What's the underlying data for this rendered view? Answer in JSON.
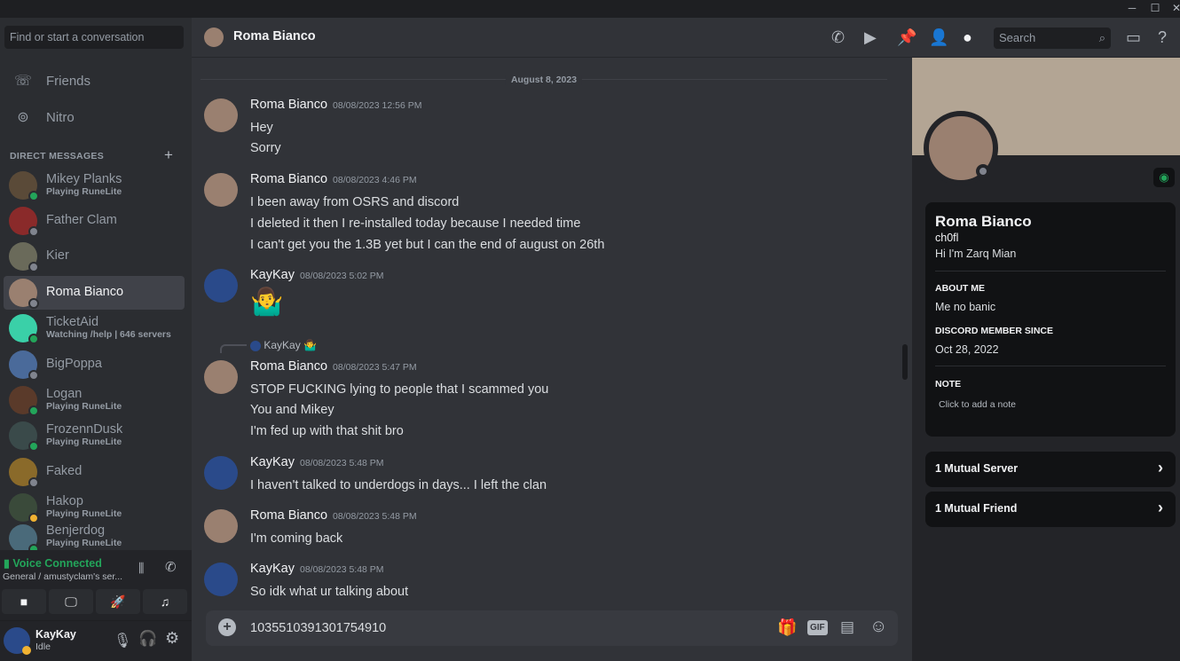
{
  "titlebar": {
    "controls": [
      "minimize",
      "maximize",
      "close"
    ]
  },
  "sidebar": {
    "search_placeholder": "Find or start a conversation",
    "nav": [
      {
        "label": "Friends",
        "icon": "friends-icon"
      },
      {
        "label": "Nitro",
        "icon": "nitro-icon"
      }
    ],
    "dm_header": "DIRECT MESSAGES",
    "dms": [
      {
        "name": "Mikey Planks",
        "activity": "Playing RuneLite",
        "status": "online",
        "color": "#5a4a38"
      },
      {
        "name": "Father Clam",
        "activity": "",
        "status": "offline",
        "color": "#8a2a2a"
      },
      {
        "name": "Kier",
        "activity": "",
        "status": "offline",
        "color": "#6a6a5a"
      },
      {
        "name": "Roma Bianco",
        "activity": "",
        "status": "offline",
        "color": "#9a8070",
        "selected": true
      },
      {
        "name": "TicketAid",
        "activity": "Watching /help | 646 servers",
        "status": "online",
        "color": "#3ad0a8"
      },
      {
        "name": "BigPoppa",
        "activity": "",
        "status": "offline",
        "color": "#4a6a9a"
      },
      {
        "name": "Logan",
        "activity": "Playing RuneLite",
        "status": "online",
        "color": "#5a3a2a"
      },
      {
        "name": "FrozennDusk",
        "activity": "Playing RuneLite",
        "status": "online",
        "color": "#3a4a4a"
      },
      {
        "name": "Faked",
        "activity": "",
        "status": "offline",
        "color": "#8a6a2a"
      },
      {
        "name": "Hakop",
        "activity": "Playing RuneLite",
        "status": "idle",
        "color": "#3a4a3a"
      },
      {
        "name": "Benjerdog",
        "activity": "Playing RuneLite",
        "status": "online",
        "color": "#4a6a7a"
      }
    ],
    "voice": {
      "status": "Voice Connected",
      "channel": "General / amustyclam's ser...",
      "color": "#23a55a"
    },
    "user": {
      "name": "KayKay",
      "status": "Idle"
    }
  },
  "header": {
    "title": "Roma Bianco",
    "search_placeholder": "Search"
  },
  "chat": {
    "date": "August 8, 2023",
    "messages": [
      {
        "author": "Roma Bianco",
        "time": "08/08/2023 12:56 PM",
        "lines": [
          "Hey",
          "Sorry"
        ]
      },
      {
        "author": "Roma Bianco",
        "time": "08/08/2023 4:46 PM",
        "lines": [
          "I been away from OSRS and discord",
          "I deleted it then I re-installed today because I needed time",
          "I can't get you the 1.3B yet but I can the end of august on 26th"
        ]
      },
      {
        "author": "KayKay",
        "time": "08/08/2023 5:02 PM",
        "lines": [
          "🤷‍♂️"
        ]
      },
      {
        "author": "Roma Bianco",
        "time": "08/08/2023 5:47 PM",
        "reply_to": "KayKay",
        "reply_text": "🤷‍♂️",
        "lines": [
          "STOP FUCKING lying to people that I scammed you",
          "You and Mikey",
          "I'm fed up with that shit bro"
        ]
      },
      {
        "author": "KayKay",
        "time": "08/08/2023 5:48 PM",
        "lines": [
          "I haven't talked to underdogs in days... I left the clan"
        ]
      },
      {
        "author": "Roma Bianco",
        "time": "08/08/2023 5:48 PM",
        "lines": [
          "I'm coming back"
        ]
      },
      {
        "author": "KayKay",
        "time": "08/08/2023 5:48 PM",
        "lines": [
          "So idk what ur talking about"
        ]
      }
    ],
    "input_value": "1035510391301754910",
    "gif_label": "GIF"
  },
  "profile": {
    "display_name": "Roma Bianco",
    "username": "ch0fl",
    "pronoun_line": "Hi I'm Zarq Mian",
    "about_label": "ABOUT ME",
    "about": "Me no banic",
    "since_label": "DISCORD MEMBER SINCE",
    "since": "Oct 28, 2022",
    "note_label": "NOTE",
    "note_placeholder": "Click to add a note",
    "mutual_server": "1 Mutual Server",
    "mutual_friend": "1 Mutual Friend",
    "banner_color": "#b3a594"
  }
}
